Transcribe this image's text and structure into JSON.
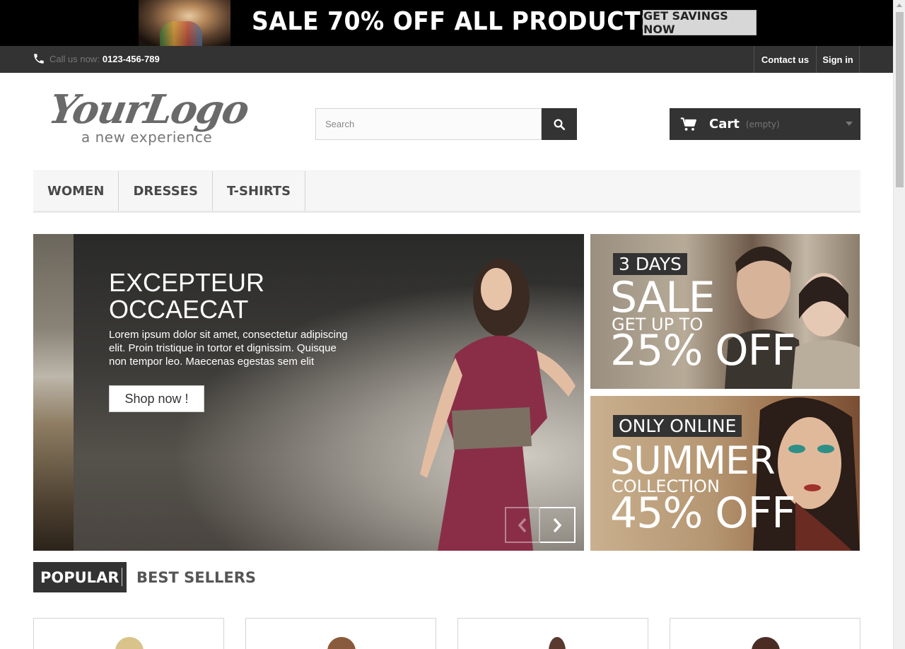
{
  "promo": {
    "text": "SALE 70% OFF ALL PRODUCTS",
    "button": "GET SAVINGS NOW"
  },
  "nav": {
    "call_label": "Call us now:",
    "phone": "0123-456-789",
    "contact": "Contact us",
    "signin": "Sign in"
  },
  "logo": {
    "name": "YourLogo",
    "tagline": "a new experience"
  },
  "search": {
    "placeholder": "Search"
  },
  "cart": {
    "label": "Cart",
    "status": "(empty)"
  },
  "menu": {
    "items": [
      {
        "label": "Women"
      },
      {
        "label": "Dresses"
      },
      {
        "label": "T-shirts"
      }
    ]
  },
  "slider": {
    "title_line1": "Excepteur",
    "title_line2": "Occaecat",
    "text": "Lorem ipsum dolor sit amet, consectetur adipiscing elit. Proin tristique in tortor et dignissim. Quisque non tempor leo. Maecenas egestas sem elit",
    "button": "Shop now !"
  },
  "banners": [
    {
      "badge": "3 DAYS",
      "headline": "SALE",
      "sub": "GET UP TO",
      "offer": "25% OFF"
    },
    {
      "badge": "ONLY ONLINE",
      "headline": "SUMMER",
      "sub": "COLLECTION",
      "offer": "45% OFF"
    }
  ],
  "tabs": {
    "popular": "Popular",
    "best": "Best Sellers"
  },
  "colors": {
    "dark": "#333333",
    "menu_bg": "#f6f6f6",
    "border": "#d6d4d4"
  }
}
